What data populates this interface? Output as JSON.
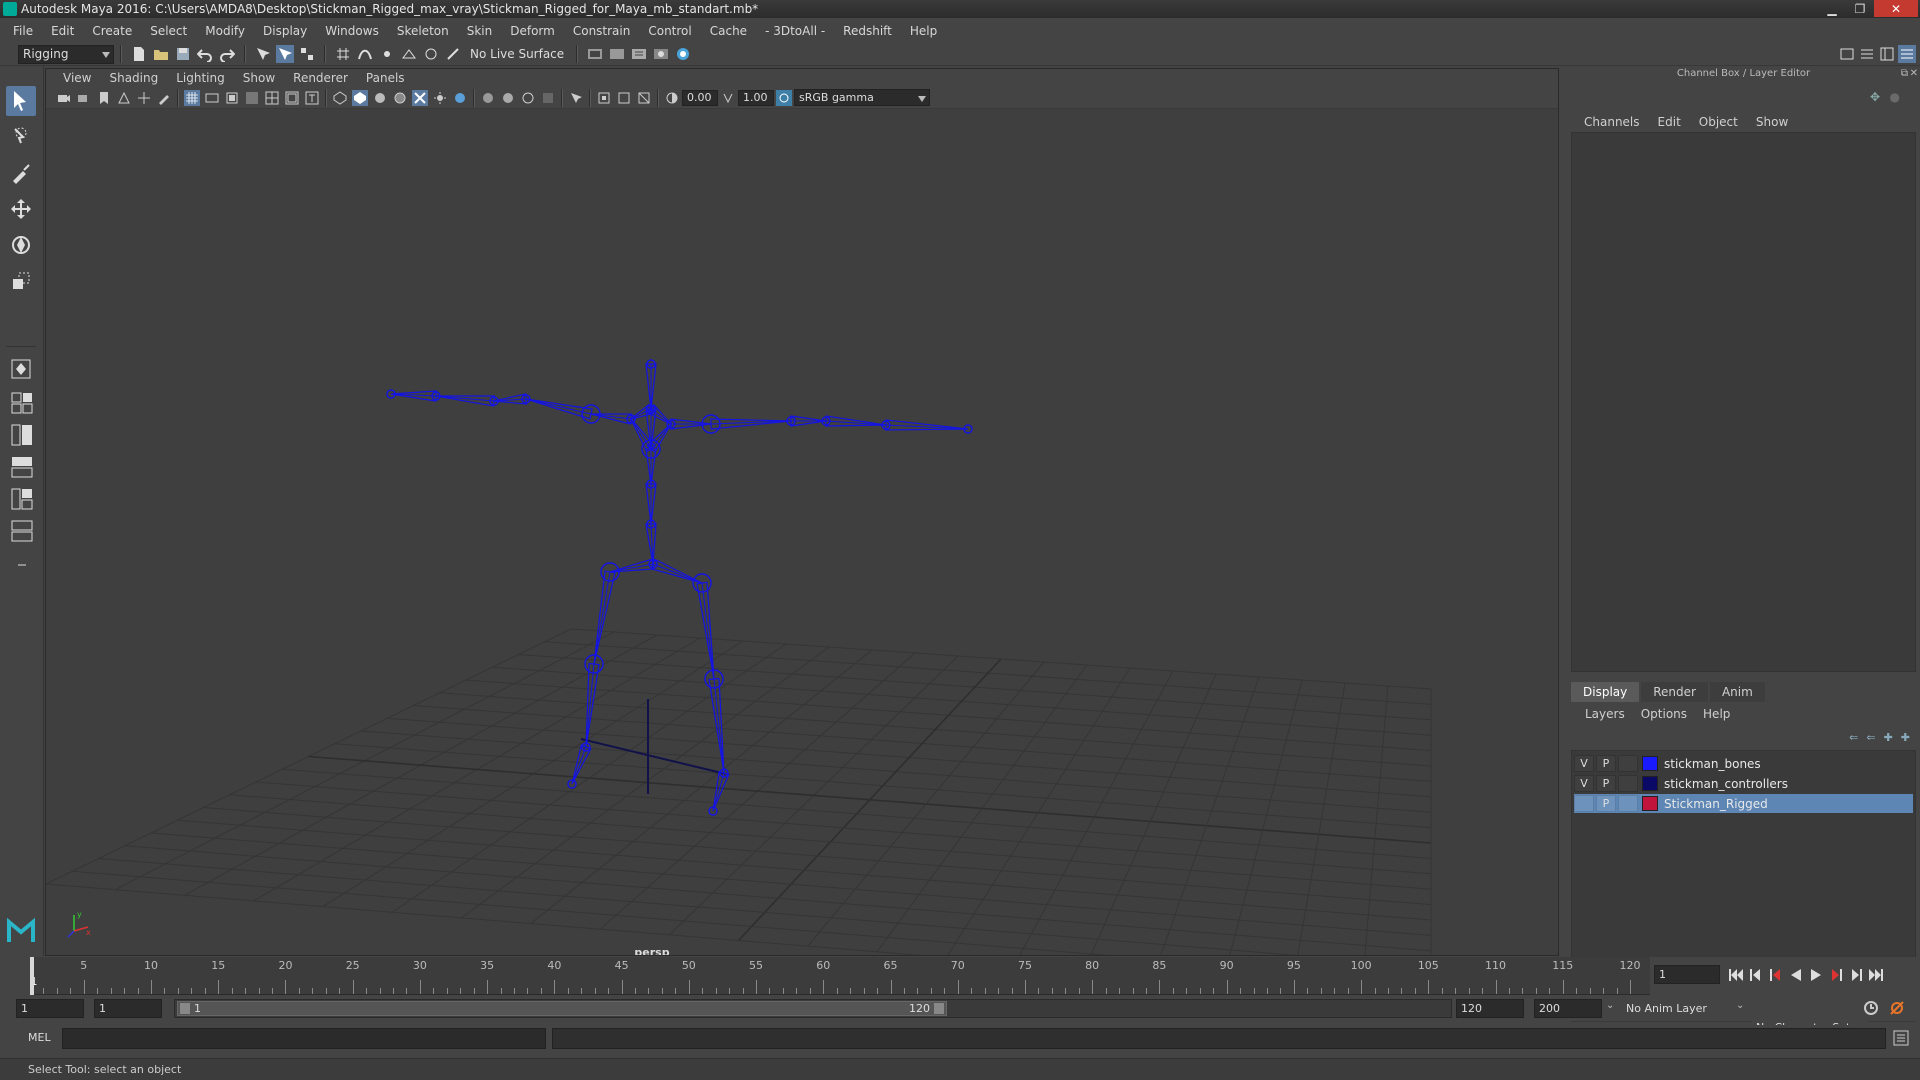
{
  "window": {
    "title": "Autodesk Maya 2016: C:\\Users\\AMDA8\\Desktop\\Stickman_Rigged_max_vray\\Stickman_Rigged_for_Maya_mb_standart.mb*",
    "minimize": "▁",
    "restore": "❐",
    "close": "✕"
  },
  "menubar": [
    "File",
    "Edit",
    "Create",
    "Select",
    "Modify",
    "Display",
    "Windows",
    "Skeleton",
    "Skin",
    "Deform",
    "Constrain",
    "Control",
    "Cache",
    "- 3DtoAll -",
    "Redshift",
    "Help"
  ],
  "statusline": {
    "menuset": "Rigging",
    "live_surface": "No Live Surface"
  },
  "viewport": {
    "menu": [
      "View",
      "Shading",
      "Lighting",
      "Show",
      "Renderer",
      "Panels"
    ],
    "exposure": "0.00",
    "gamma": "1.00",
    "color_space": "sRGB gamma",
    "camera_label": "persp",
    "skeleton_color": "#1414e6"
  },
  "channel_box": {
    "header": "Channel Box / Layer Editor",
    "menu": [
      "Channels",
      "Edit",
      "Object",
      "Show"
    ]
  },
  "layer_editor": {
    "tabs": [
      "Display",
      "Render",
      "Anim"
    ],
    "active_tab": "Display",
    "menu": [
      "Layers",
      "Options",
      "Help"
    ],
    "layers": [
      {
        "v": "V",
        "p": "P",
        "color": "#1a1aff",
        "name": "stickman_bones",
        "selected": false
      },
      {
        "v": "V",
        "p": "P",
        "color": "#0a0a66",
        "name": "stickman_controllers",
        "selected": false
      },
      {
        "v": "",
        "p": "P",
        "color": "#c0143c",
        "name": "Stickman_Rigged",
        "selected": true
      }
    ]
  },
  "timeline": {
    "ticks": [
      "1",
      "5",
      "10",
      "15",
      "20",
      "25",
      "30",
      "35",
      "40",
      "45",
      "50",
      "55",
      "60",
      "65",
      "70",
      "75",
      "80",
      "85",
      "90",
      "95",
      "100",
      "105",
      "110",
      "115",
      "120"
    ],
    "current_frame": "1"
  },
  "range": {
    "start": "1",
    "playback_start": "1",
    "slider_start": "1",
    "slider_end": "120",
    "playback_end": "120",
    "end": "200",
    "anim_layer": "No Anim Layer",
    "character_set": "No Character Set"
  },
  "command": {
    "language": "MEL"
  },
  "helpline": "Select Tool: select an object"
}
